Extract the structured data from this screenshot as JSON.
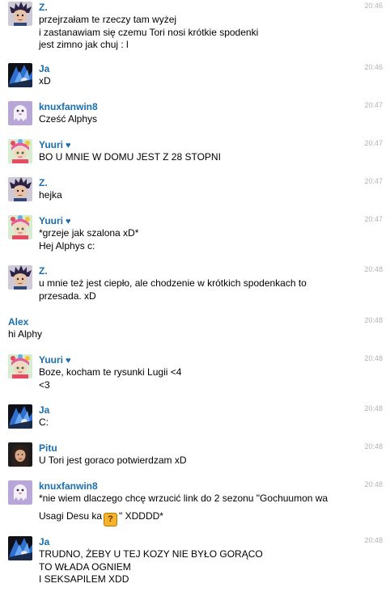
{
  "messages": [
    {
      "user": "Z.",
      "time": "20:46",
      "avatar": "avatar-z",
      "lines": [
        "przejrzałam te rzeczy tam wyżej",
        "i zastanawiam się czemu Tori nosi krótkie spodenki",
        "jest zimno jak chuj : l"
      ]
    },
    {
      "user": "Ja",
      "time": "20:46",
      "avatar": "avatar-ja",
      "lines": [
        "xD"
      ]
    },
    {
      "user": "knuxfanwin8",
      "time": "20:47",
      "avatar": "avatar-knux",
      "lines": [
        "Cześć Alphys"
      ]
    },
    {
      "user": "Yuuri",
      "time": "20:47",
      "avatar": "avatar-yuuri",
      "heart": "♥",
      "lines": [
        "BO U MNIE W DOMU JEST Z 28 STOPNI"
      ]
    },
    {
      "user": "Z.",
      "time": "20:47",
      "avatar": "avatar-z",
      "lines": [
        "hejka"
      ]
    },
    {
      "user": "Yuuri",
      "time": "20:47",
      "avatar": "avatar-yuuri",
      "heart": "♥",
      "lines": [
        "*grzeje jak szalona xD*",
        "Hej Alphys c:"
      ]
    },
    {
      "user": "Z.",
      "time": "20:48",
      "avatar": "avatar-z",
      "lines": [
        "u mnie też jest ciepło, ale chodzenie w krótkich spodenkach to",
        "przesada. xD"
      ]
    },
    {
      "user": "Alex",
      "time": "20:48",
      "avatar": "",
      "lines": [
        "hi Alphy"
      ]
    },
    {
      "user": "Yuuri",
      "time": "20:48",
      "avatar": "avatar-yuuri",
      "heart": "♥",
      "lines": [
        "Boze, kocham te rysunki Lugii <4",
        "<3"
      ]
    },
    {
      "user": "Ja",
      "time": "20:48",
      "avatar": "avatar-ja",
      "lines": [
        "C:"
      ]
    },
    {
      "user": "Pitu",
      "time": "20:48",
      "avatar": "avatar-pitu",
      "lines": [
        "U Tori jest goraco potwierdzam xD"
      ]
    },
    {
      "user": "knuxfanwin8",
      "time": "20:48",
      "avatar": "avatar-knux",
      "lines": [
        "*nie wiem dlaczego chcę wrzucić link do 2 sezonu \"Gochuumon wa"
      ],
      "emote_line": {
        "before": "Usagi Desu ka",
        "emote_icon": "question-emoticon-icon",
        "emote_glyph": "?",
        "after": "\" XDDDD*"
      }
    },
    {
      "user": "Ja",
      "time": "20:48",
      "avatar": "avatar-ja",
      "lines": [
        "TRUDNO, ŻEBY U TEJ KOZY NIE BYŁO GORĄCO",
        "TO WŁADA OGNIEM",
        "I SEKSAPILEM XDD"
      ]
    }
  ]
}
